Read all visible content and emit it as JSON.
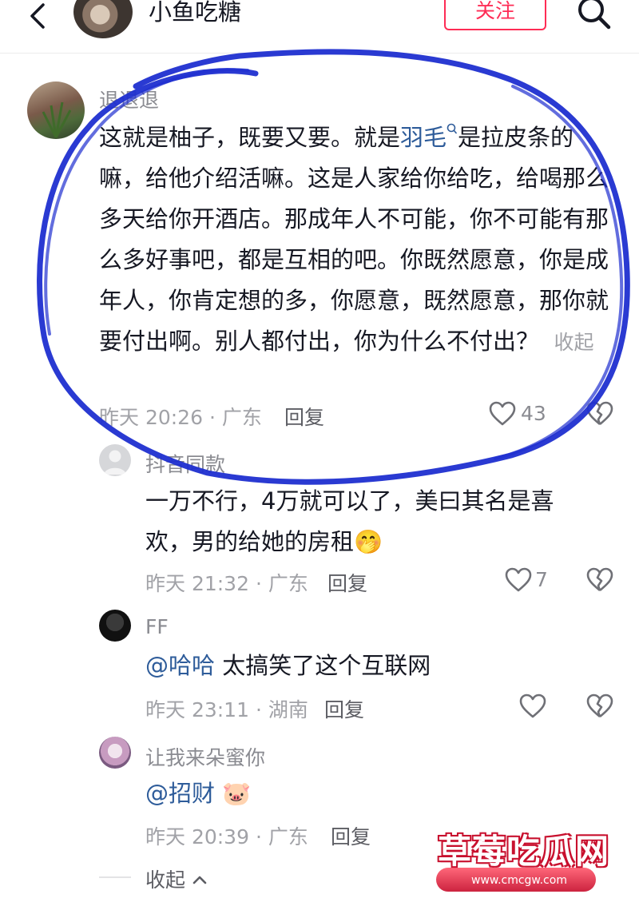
{
  "header": {
    "account_name": "小鱼吃糖",
    "follow_label": "关注"
  },
  "comments": [
    {
      "username": "退退退",
      "text_before": "这就是柚子，既要又要。就是",
      "keyword": "羽毛",
      "text_after": "是拉皮条的嘛，给他介绍活嘛。这是人家给你给吃，给喝那么多天给你开酒店。那成年人不可能，你不可能有那么多好事吧，都是互相的吧。你既然愿意，你是成年人，你肯定想的多，你愿意，既然愿意，那你就要付出啊。别人都付出，你为什么不付出？",
      "collapse_label": "收起",
      "meta": "昨天 20:26 · 广东",
      "reply_label": "回复",
      "like_count": "43"
    },
    {
      "username": "抖音同款",
      "text": "一万不行，4万就可以了，美曰其名是喜欢，男的给她的房租",
      "emoji": "🤭",
      "meta": "昨天 21:32 · 广东",
      "reply_label": "回复",
      "like_count": "7"
    },
    {
      "username": "FF",
      "mention": "@哈哈",
      "text": " 太搞笑了这个互联网",
      "meta": "昨天 23:11 · 湖南",
      "reply_label": "回复"
    },
    {
      "username": "让我来朵蜜你",
      "mention": "@招财",
      "emoji": "🐷",
      "meta": "昨天 20:39 · 广东",
      "reply_label": "回复"
    }
  ],
  "collapse_replies_label": "收起",
  "watermark": {
    "title": "草莓吃瓜网",
    "url": "www.cmcgw.com"
  },
  "colors": {
    "follow_red": "#fe2c55",
    "mention_blue": "#2e5c9a",
    "annotation_blue": "#1f2fd0"
  }
}
